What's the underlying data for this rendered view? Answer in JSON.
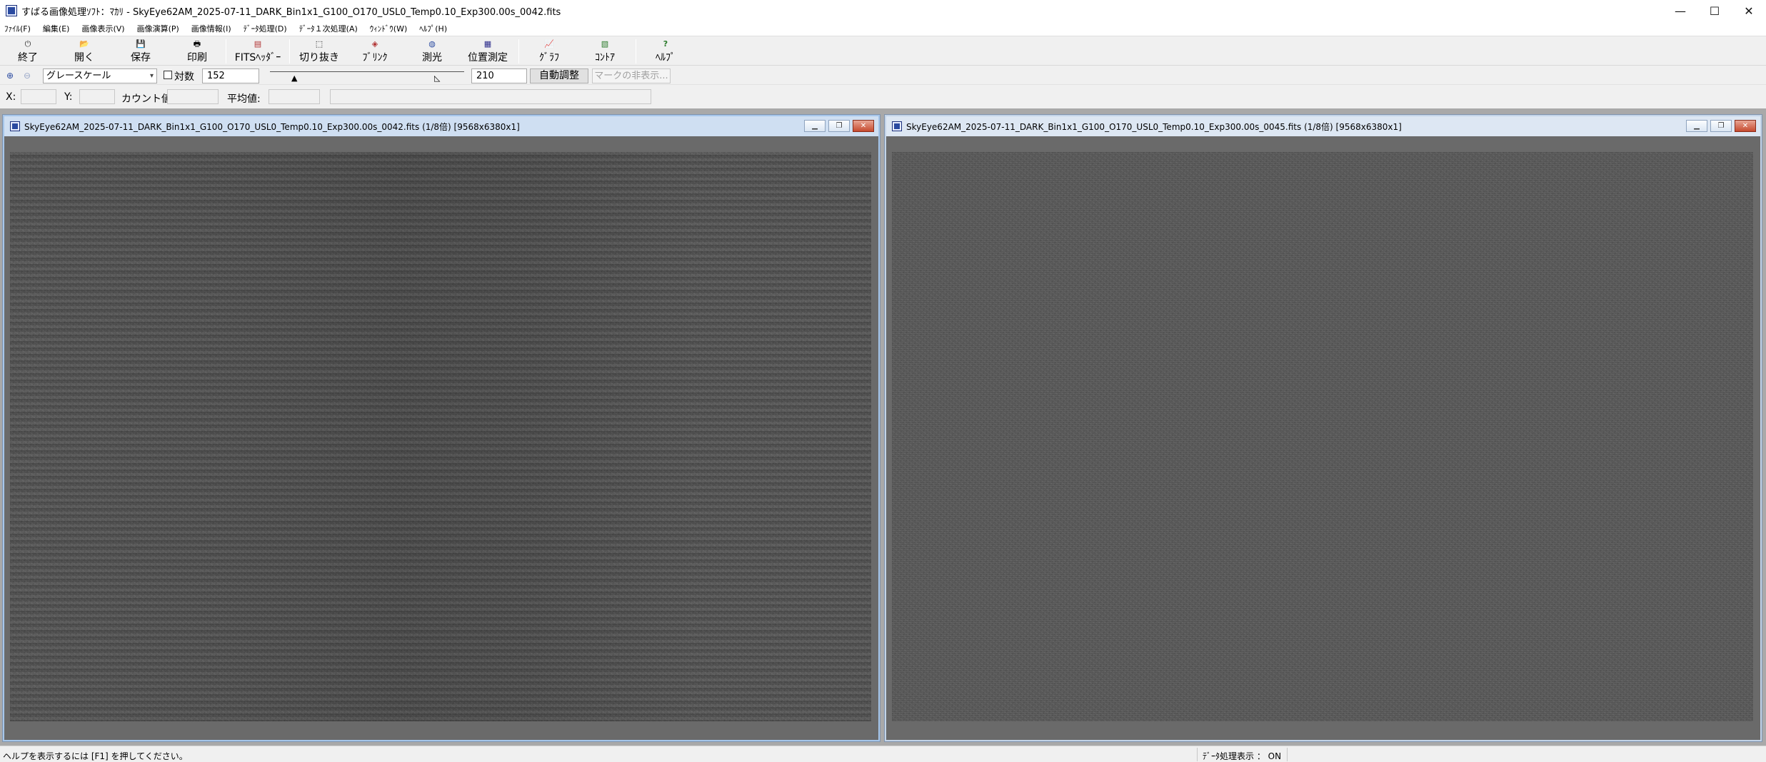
{
  "window": {
    "title": "すばる画像処理ｿﾌﾄ：ﾏｶﾘ - SkyEye62AM_2025-07-11_DARK_Bin1x1_G100_O170_USL0_Temp0.10_Exp300.00s_0042.fits",
    "controls": {
      "minimize": "—",
      "maximize": "☐",
      "close": "✕"
    }
  },
  "menu": {
    "items": [
      "ﾌｧｲﾙ(F)",
      "編集(E)",
      "画像表示(V)",
      "画像演算(P)",
      "画像情報(I)",
      "ﾃﾞｰﾀ処理(D)",
      "ﾃﾞｰﾀ１次処理(A)",
      "ｳｨﾝﾄﾞｳ(W)",
      "ﾍﾙﾌﾟ(H)"
    ]
  },
  "toolbar": {
    "items": [
      {
        "label": "終了",
        "icon": "power-icon",
        "glyph": "⏻"
      },
      {
        "label": "開く",
        "icon": "open-folder-icon",
        "glyph": "📂"
      },
      {
        "label": "保存",
        "icon": "floppy-disk-icon",
        "glyph": "💾"
      },
      {
        "label": "印刷",
        "icon": "printer-icon",
        "glyph": "🖶"
      },
      {
        "label": "FITSﾍｯﾀﾞｰ",
        "icon": "fits-header-icon",
        "glyph": "▤"
      },
      {
        "label": "切り抜き",
        "icon": "crop-icon",
        "glyph": "⬚"
      },
      {
        "label": "ﾌﾞﾘﾝｸ",
        "icon": "blink-icon",
        "glyph": "◈"
      },
      {
        "label": "測光",
        "icon": "photometry-icon",
        "glyph": "◍"
      },
      {
        "label": "位置測定",
        "icon": "position-measure-icon",
        "glyph": "▦"
      },
      {
        "label": "ｸﾞﾗﾌ",
        "icon": "graph-icon",
        "glyph": "📈"
      },
      {
        "label": "ｺﾝﾄｱ",
        "icon": "contour-icon",
        "glyph": "▧"
      },
      {
        "label": "ﾍﾙﾌﾟ",
        "icon": "help-icon",
        "glyph": "?"
      }
    ]
  },
  "display_controls": {
    "zoom_in_icon": "zoom-in-icon",
    "zoom_out_icon": "zoom-out-icon",
    "color_mode": "グレースケール",
    "log_scale_label": "対数",
    "log_scale_checked": false,
    "min_value": "152",
    "max_value": "210",
    "auto_adjust_label": "自動調整",
    "hide_marks_label": "マークの非表示..."
  },
  "pixel_info": {
    "x_label": "X:",
    "y_label": "Y:",
    "count_label": "カウント値:",
    "mean_label": "平均値:"
  },
  "child_windows": [
    {
      "title": "SkyEye62AM_2025-07-11_DARK_Bin1x1_G100_O170_USL0_Temp0.10_Exp300.00s_0042.fits (1/8倍) [9568x6380x1]",
      "active": true
    },
    {
      "title": "SkyEye62AM_2025-07-11_DARK_Bin1x1_G100_O170_USL0_Temp0.10_Exp300.00s_0045.fits (1/8倍) [9568x6380x1]",
      "active": false
    }
  ],
  "status": {
    "help_text": "ヘルプを表示するには [F1] を押してください。",
    "data_processing": "ﾃﾞｰﾀ処理表示 ： ON"
  }
}
